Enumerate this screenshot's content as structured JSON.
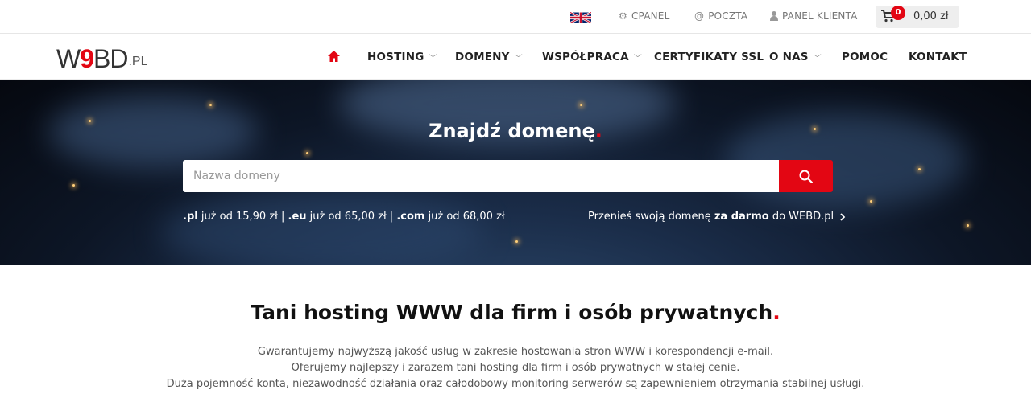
{
  "topbar": {
    "language_icon": "uk-flag-icon",
    "cpanel": "CPANEL",
    "poczta": "POCZTA",
    "panel_klienta": "PANEL KLIENTA",
    "cart_count": "0",
    "cart_amount": "0,00 zł"
  },
  "logo": {
    "w": "W",
    "nine": "9",
    "bd": "BD",
    "pl": ".PL"
  },
  "nav": {
    "items": [
      {
        "label": "HOSTING",
        "dropdown": true
      },
      {
        "label": "DOMENY",
        "dropdown": true
      },
      {
        "label": "WSPÓŁPRACA",
        "dropdown": true
      },
      {
        "label": "CERTYFIKATY SSL",
        "dropdown": false
      },
      {
        "label": "O NAS",
        "dropdown": true
      },
      {
        "label": "POMOC",
        "dropdown": false
      },
      {
        "label": "KONTAKT",
        "dropdown": false
      }
    ]
  },
  "hero": {
    "title": "Znajdź domenę",
    "title_dot": ".",
    "search_placeholder": "Nazwa domeny",
    "prices": {
      "pl_ext": ".pl",
      "pl_text": " już od 15,90 zł | ",
      "eu_ext": ".eu",
      "eu_text": " już od 65,00 zł | ",
      "com_ext": ".com",
      "com_text": " już od 68,00 zł"
    },
    "transfer": {
      "pre": "Przenieś swoją domenę ",
      "bold": "za darmo",
      "post": " do WEBD.pl"
    }
  },
  "main": {
    "title": "Tani hosting WWW dla firm i osób prywatnych",
    "title_dot": ".",
    "lines": [
      "Gwarantujemy najwyższą jakość usług w zakresie hostowania stron WWW i korespondencji e-mail.",
      "Oferujemy najlepszy i zarazem tani hosting dla firm i osób prywatnych w stałej cenie.",
      "Duża pojemność konta, niezawodność działania oraz całodobowy monitoring serwerów są zapewnieniem otrzymania stabilnej usługi."
    ]
  },
  "colors": {
    "accent": "#e30613",
    "text": "#222222"
  }
}
